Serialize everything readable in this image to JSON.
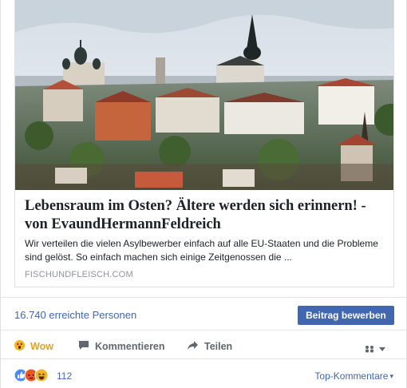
{
  "link_preview": {
    "title": "Lebensraum im Osten? Ältere werden sich erinnern! - von EvaundHermannFeldreich",
    "description": "Wir verteilen die vielen Asylbewerber einfach auf alle EU-Staaten und die Probleme sind gelöst. So einfach machen sich einige Zeitgenossen die ...",
    "domain": "FISCHUNDFLEISCH.COM",
    "image_icon": "old-town-skyline-photo"
  },
  "promotion": {
    "reach_text": "16.740 erreichte Personen",
    "boost_label": "Beitrag bewerben"
  },
  "actions": {
    "wow_label": "Wow",
    "comment_label": "Kommentieren",
    "share_label": "Teilen"
  },
  "reactions": {
    "count": "112",
    "top_comments_label": "Top-Kommentare"
  },
  "colors": {
    "accent": "#4267b2",
    "wow": "#e5a023",
    "muted": "#606770"
  }
}
